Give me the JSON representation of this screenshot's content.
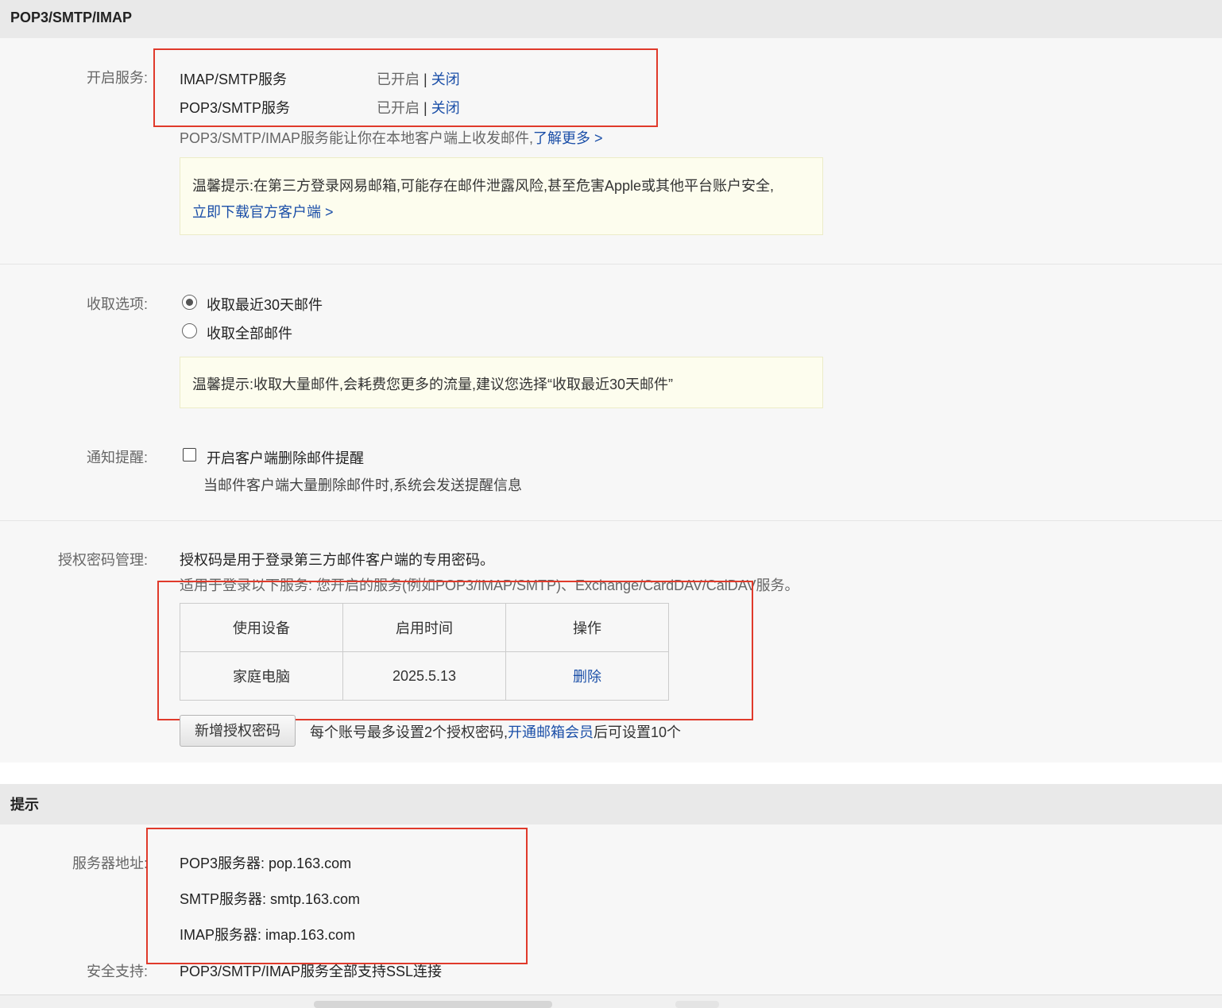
{
  "section1": {
    "title": "POP3/SMTP/IMAP",
    "service_label": "开启服务:",
    "services": [
      {
        "name": "IMAP/SMTP服务",
        "status": "已开启",
        "separator": "|",
        "action": "关闭"
      },
      {
        "name": "POP3/SMTP服务",
        "status": "已开启",
        "separator": "|",
        "action": "关闭"
      }
    ],
    "desc_text": "POP3/SMTP/IMAP服务能让你在本地客户端上收发邮件,",
    "desc_link": "了解更多 >",
    "warning1_text": "温馨提示:在第三方登录网易邮箱,可能存在邮件泄露风险,甚至危害Apple或其他平台账户安全,",
    "warning1_link": "立即下载官方客户端 >",
    "fetch_label": "收取选项:",
    "fetch_options": [
      {
        "label": "收取最近30天邮件",
        "checked": true
      },
      {
        "label": "收取全部邮件",
        "checked": false
      }
    ],
    "warning2_text": "温馨提示:收取大量邮件,会耗费您更多的流量,建议您选择“收取最近30天邮件”",
    "notify_label": "通知提醒:",
    "notify_checkbox_label": "开启客户端删除邮件提醒",
    "notify_checked": false,
    "notify_desc": "当邮件客户端大量删除邮件时,系统会发送提醒信息",
    "auth_label": "授权密码管理:",
    "auth_desc1": "授权码是用于登录第三方邮件客户端的专用密码。",
    "auth_desc2": "适用于登录以下服务: 您开启的服务(例如POP3/IMAP/SMTP)、Exchange/CardDAV/CalDAV服务。",
    "auth_table": {
      "headers": [
        "使用设备",
        "启用时间",
        "操作"
      ],
      "rows": [
        {
          "device": "家庭电脑",
          "date": "2025.5.13",
          "action": "删除"
        }
      ]
    },
    "add_button": "新增授权密码",
    "limit_text_before": "每个账号最多设置2个授权密码,",
    "limit_link": "开通邮箱会员",
    "limit_text_after": "后可设置10个"
  },
  "section2": {
    "title": "提示",
    "server_label": "服务器地址:",
    "servers": [
      "POP3服务器: pop.163.com",
      "SMTP服务器: smtp.163.com",
      "IMAP服务器: imap.163.com"
    ],
    "security_label": "安全支持:",
    "security_text": "POP3/SMTP/IMAP服务全部支持SSL连接"
  },
  "colors": {
    "link": "#1b4fa8",
    "highlight_frame": "#e03a2b",
    "warning_bg": "#fdfdee",
    "header_bg": "#e9e9e9"
  }
}
